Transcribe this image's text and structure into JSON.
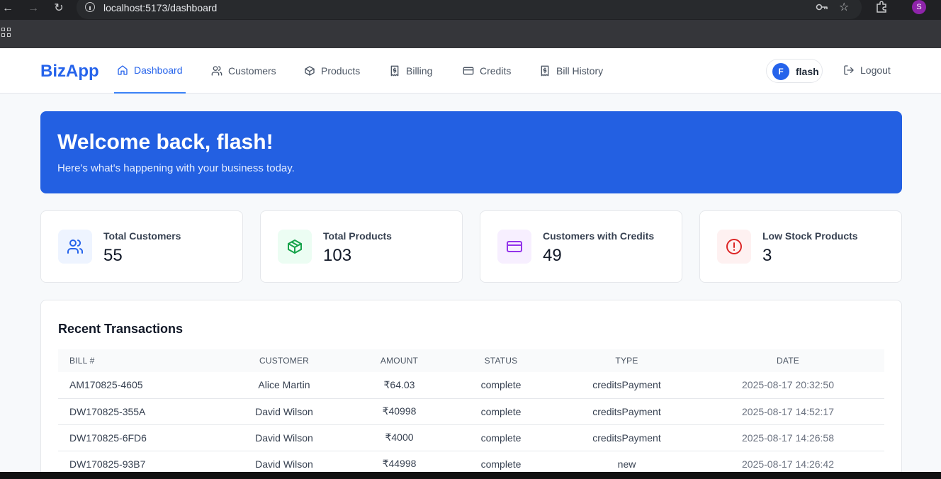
{
  "browser": {
    "url": "localhost:5173/dashboard",
    "profile_initial": "S"
  },
  "app": {
    "logo": "BizApp",
    "nav": [
      {
        "label": "Dashboard",
        "icon": "home-icon"
      },
      {
        "label": "Customers",
        "icon": "users-icon"
      },
      {
        "label": "Products",
        "icon": "package-icon"
      },
      {
        "label": "Billing",
        "icon": "receipt-icon"
      },
      {
        "label": "Credits",
        "icon": "credit-card-icon"
      },
      {
        "label": "Bill History",
        "icon": "receipt-icon"
      }
    ],
    "user": {
      "initial": "F",
      "name": "flash"
    },
    "logout_label": "Logout"
  },
  "banner": {
    "title": "Welcome back, flash!",
    "subtitle": "Here's what's happening with your business today."
  },
  "stats": [
    {
      "label": "Total Customers",
      "value": "55",
      "icon": "users-icon",
      "color": "#2563eb",
      "bg": "#eef4ff"
    },
    {
      "label": "Total Products",
      "value": "103",
      "icon": "package-icon",
      "color": "#16a34a",
      "bg": "#ecfdf3"
    },
    {
      "label": "Customers with Credits",
      "value": "49",
      "icon": "credit-card-icon",
      "color": "#9333ea",
      "bg": "#f7efff"
    },
    {
      "label": "Low Stock Products",
      "value": "3",
      "icon": "alert-circle-icon",
      "color": "#dc2626",
      "bg": "#fef1f1"
    }
  ],
  "transactions": {
    "title": "Recent Transactions",
    "columns": [
      "Bill #",
      "Customer",
      "Amount",
      "Status",
      "Type",
      "Date"
    ],
    "rows": [
      [
        "AM170825-4605",
        "Alice Martin",
        "₹64.03",
        "complete",
        "creditsPayment",
        "2025-08-17 20:32:50"
      ],
      [
        "DW170825-355A",
        "David Wilson",
        "₹40998",
        "complete",
        "creditsPayment",
        "2025-08-17 14:52:17"
      ],
      [
        "DW170825-6FD6",
        "David Wilson",
        "₹4000",
        "complete",
        "creditsPayment",
        "2025-08-17 14:26:58"
      ],
      [
        "DW170825-93B7",
        "David Wilson",
        "₹44998",
        "complete",
        "new",
        "2025-08-17 14:26:42"
      ]
    ]
  },
  "colors": {
    "brand": "#2563eb",
    "banner": "#2360e2"
  }
}
